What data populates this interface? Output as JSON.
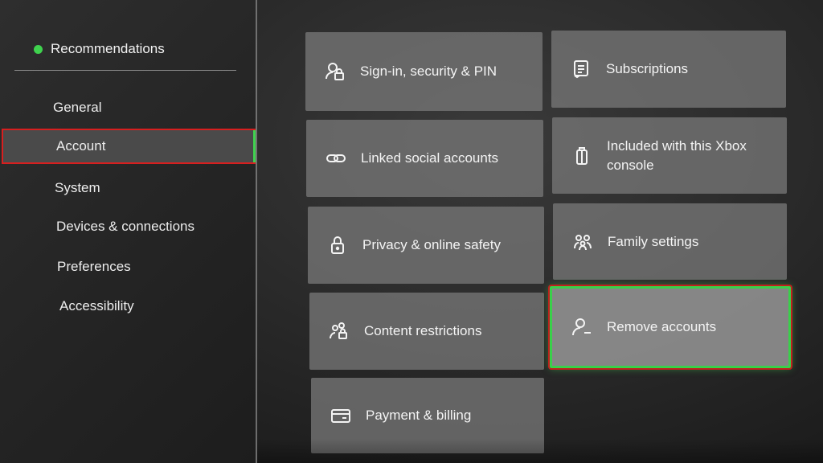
{
  "sidebar": {
    "recommendations_label": "Recommendations",
    "items": [
      {
        "label": "General"
      },
      {
        "label": "Account"
      },
      {
        "label": "System"
      },
      {
        "label": "Devices & connections"
      },
      {
        "label": "Preferences"
      },
      {
        "label": "Accessibility"
      }
    ],
    "selected_index": 1
  },
  "tiles": [
    {
      "label": "Sign-in, security & PIN",
      "icon": "user-lock-icon"
    },
    {
      "label": "Subscriptions",
      "icon": "receipt-icon"
    },
    {
      "label": "Linked social accounts",
      "icon": "link-icon"
    },
    {
      "label": "Included with this Xbox console",
      "icon": "gift-icon"
    },
    {
      "label": "Privacy & online safety",
      "icon": "lock-icon"
    },
    {
      "label": "Family settings",
      "icon": "family-icon"
    },
    {
      "label": "Content restrictions",
      "icon": "people-lock-icon"
    },
    {
      "label": "Remove accounts",
      "icon": "person-remove-icon"
    },
    {
      "label": "Payment & billing",
      "icon": "credit-card-icon"
    }
  ],
  "focused_tile": "Remove accounts",
  "colors": {
    "accent_green": "#3fd24e",
    "highlight_red": "#d71f1f",
    "tile_background": "#767676"
  }
}
